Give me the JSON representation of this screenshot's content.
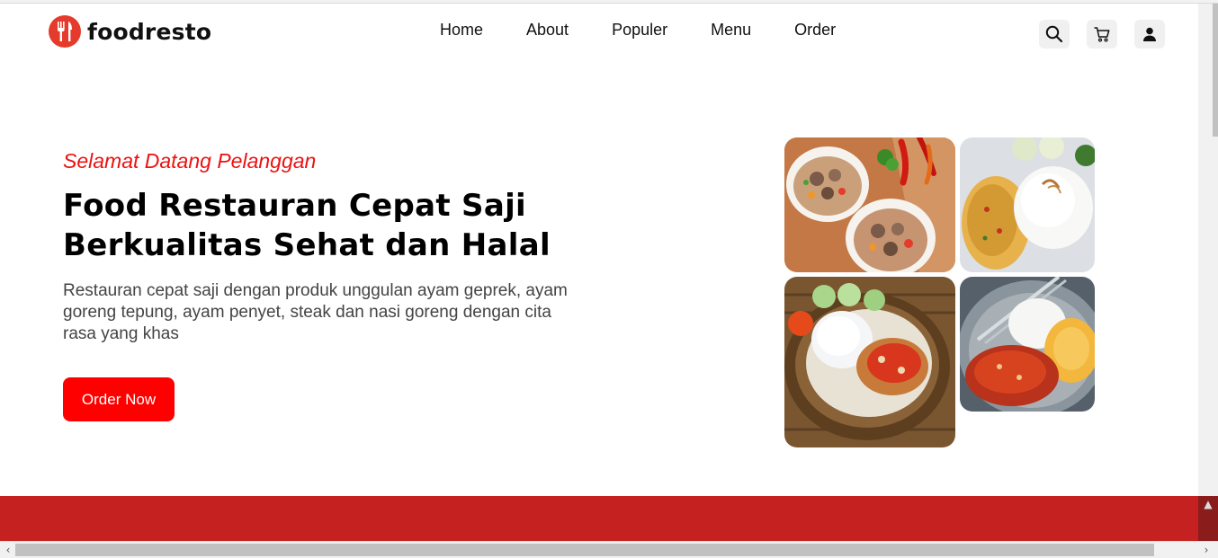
{
  "brand": {
    "name": "foodresto",
    "accent": "#e53b2c"
  },
  "nav": {
    "items": [
      {
        "label": "Home"
      },
      {
        "label": "About"
      },
      {
        "label": "Populer"
      },
      {
        "label": "Menu"
      },
      {
        "label": "Order"
      }
    ]
  },
  "header_icons": [
    "search-icon",
    "cart-icon",
    "user-icon"
  ],
  "hero": {
    "welcome": "Selamat Datang Pelanggan",
    "headline_line1": "Food Restauran Cepat Saji",
    "headline_line2": "Berkualitas Sehat dan Halal",
    "description": "Restauran cepat saji dengan produk unggulan ayam geprek, ayam goreng tepung, ayam penyet, steak dan nasi goreng dengan cita rasa yang khas",
    "cta_label": "Order Now",
    "cta_color": "#ff0000"
  },
  "colors": {
    "welcome": "#ee1111",
    "band": "#c62121"
  }
}
